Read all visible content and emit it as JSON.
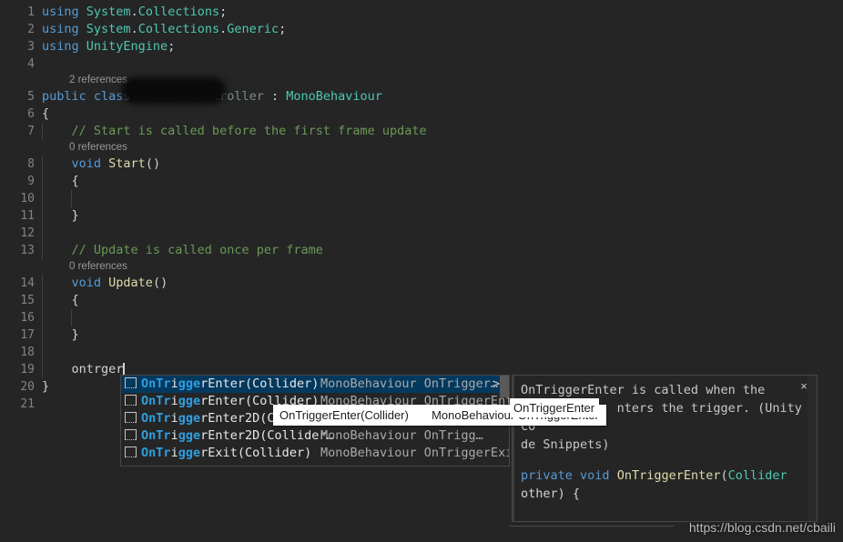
{
  "editor": {
    "background": "#252526",
    "lines": [
      {
        "num": "1",
        "type": "code",
        "tokens": [
          {
            "t": "using ",
            "c": "kw"
          },
          {
            "t": "System",
            "c": "ns"
          },
          {
            "t": ".",
            "c": "punc"
          },
          {
            "t": "Collections",
            "c": "ns"
          },
          {
            "t": ";",
            "c": "punc"
          }
        ]
      },
      {
        "num": "2",
        "type": "code",
        "tokens": [
          {
            "t": "using ",
            "c": "kw"
          },
          {
            "t": "System",
            "c": "ns"
          },
          {
            "t": ".",
            "c": "punc"
          },
          {
            "t": "Collections",
            "c": "ns"
          },
          {
            "t": ".",
            "c": "punc"
          },
          {
            "t": "Generic",
            "c": "ns"
          },
          {
            "t": ";",
            "c": "punc"
          }
        ]
      },
      {
        "num": "3",
        "type": "code",
        "tokens": [
          {
            "t": "using ",
            "c": "kw"
          },
          {
            "t": "UnityEngine",
            "c": "ns"
          },
          {
            "t": ";",
            "c": "punc"
          }
        ]
      },
      {
        "num": "4",
        "type": "code",
        "tokens": []
      },
      {
        "num": "",
        "type": "codelens",
        "text": "2 references"
      },
      {
        "num": "5",
        "type": "code",
        "tokens": [
          {
            "t": "public",
            "c": "kw"
          },
          {
            "t": " ",
            "c": "plain"
          },
          {
            "t": "class",
            "c": "kw"
          },
          {
            "t": " ",
            "c": "plain"
          },
          {
            "t": "StudentController",
            "c": "redact"
          },
          {
            "t": " : ",
            "c": "punc"
          },
          {
            "t": "MonoBehaviour",
            "c": "ns"
          }
        ]
      },
      {
        "num": "6",
        "type": "code",
        "tokens": [
          {
            "t": "{",
            "c": "punc"
          }
        ]
      },
      {
        "num": "7",
        "type": "code",
        "indent": 1,
        "tokens": [
          {
            "t": "    // Start is called before the first frame update",
            "c": "cmt"
          }
        ]
      },
      {
        "num": "",
        "type": "codelens",
        "text": "0 references"
      },
      {
        "num": "8",
        "type": "code",
        "indent": 1,
        "tokens": [
          {
            "t": "    ",
            "c": "plain"
          },
          {
            "t": "void",
            "c": "kw"
          },
          {
            "t": " ",
            "c": "plain"
          },
          {
            "t": "Start",
            "c": "fn"
          },
          {
            "t": "()",
            "c": "punc"
          }
        ]
      },
      {
        "num": "9",
        "type": "code",
        "indent": 1,
        "tokens": [
          {
            "t": "    {",
            "c": "punc"
          }
        ]
      },
      {
        "num": "10",
        "type": "code",
        "indent": 2,
        "tokens": []
      },
      {
        "num": "11",
        "type": "code",
        "indent": 1,
        "tokens": [
          {
            "t": "    }",
            "c": "punc"
          }
        ]
      },
      {
        "num": "12",
        "type": "code",
        "indent": 1,
        "tokens": []
      },
      {
        "num": "13",
        "type": "code",
        "indent": 1,
        "tokens": [
          {
            "t": "    // Update is called once per frame",
            "c": "cmt"
          }
        ]
      },
      {
        "num": "",
        "type": "codelens",
        "text": "0 references"
      },
      {
        "num": "14",
        "type": "code",
        "indent": 1,
        "tokens": [
          {
            "t": "    ",
            "c": "plain"
          },
          {
            "t": "void",
            "c": "kw"
          },
          {
            "t": " ",
            "c": "plain"
          },
          {
            "t": "Update",
            "c": "fn"
          },
          {
            "t": "()",
            "c": "punc"
          }
        ]
      },
      {
        "num": "15",
        "type": "code",
        "indent": 1,
        "tokens": [
          {
            "t": "    {",
            "c": "punc"
          }
        ]
      },
      {
        "num": "16",
        "type": "code",
        "indent": 2,
        "tokens": []
      },
      {
        "num": "17",
        "type": "code",
        "indent": 1,
        "tokens": [
          {
            "t": "    }",
            "c": "punc"
          }
        ]
      },
      {
        "num": "18",
        "type": "code",
        "indent": 1,
        "tokens": []
      },
      {
        "num": "19",
        "type": "code",
        "indent": 1,
        "caret": true,
        "tokens": [
          {
            "t": "    ontrger",
            "c": "plain"
          }
        ]
      },
      {
        "num": "20",
        "type": "code",
        "tokens": [
          {
            "t": "}",
            "c": "punc"
          }
        ]
      },
      {
        "num": "21",
        "type": "code",
        "tokens": []
      }
    ],
    "caret_line_text": "ontrger",
    "redacted_class_name": "StudentController"
  },
  "completion": {
    "icon_name": "snippet-icon",
    "rows": [
      {
        "selected": true,
        "match": "OnTr",
        "mid": "i",
        "match2": "gg",
        "rest": "erEnter(Collider)",
        "label_plain": "OnTriggerEnter(Collider)",
        "detail": "MonoBehaviour OnTrigger…",
        "more": ">"
      },
      {
        "selected": false,
        "label_plain": "OnTriggerEnter(Collider)",
        "detail": "MonoBehaviour OnTriggerEnter",
        "more": ""
      },
      {
        "selected": false,
        "label_plain": "OnTriggerEnter2D(Collider2D)",
        "detail": "MonoBehaviour OnTriggerEnter2D",
        "more": ""
      },
      {
        "selected": false,
        "label_plain": "OnTriggerEnter2D(Collider…",
        "detail": "MonoBehaviour OnTrigg…",
        "more": ""
      },
      {
        "selected": false,
        "label_plain": "OnTriggerExit(Collider)",
        "detail": "MonoBehaviour OnTriggerExit",
        "more": ""
      }
    ],
    "selected_index": 0,
    "highlight_color": "#04395e",
    "match_color": "#2f9fe0"
  },
  "signature_tooltip": {
    "signature": "OnTriggerEnter(Collider)",
    "owner": "MonoBehaviour OnTriggerEnter"
  },
  "doc_panel": {
    "description": "OnTriggerEnter is called when the Colli        nters the trigger. (Unity Co\nde Snippets)",
    "close_label": "×",
    "close_icon_name": "close-icon",
    "snippet": [
      {
        "t": "private",
        "c": "kw"
      },
      {
        "t": " ",
        "c": "plain"
      },
      {
        "t": "void",
        "c": "kw"
      },
      {
        "t": " ",
        "c": "plain"
      },
      {
        "t": "OnTriggerEnter",
        "c": "fn"
      },
      {
        "t": "(",
        "c": "punc"
      },
      {
        "t": "Collider",
        "c": "ns"
      },
      {
        "t": " other",
        "c": "plain"
      },
      {
        "t": ") {",
        "c": "punc"
      },
      {
        "t": "\n\n}",
        "c": "punc"
      }
    ]
  },
  "doc_name_tooltip": {
    "text": "OnTriggerEnter"
  },
  "watermark": {
    "text": "https://blog.csdn.net/cbaili"
  }
}
